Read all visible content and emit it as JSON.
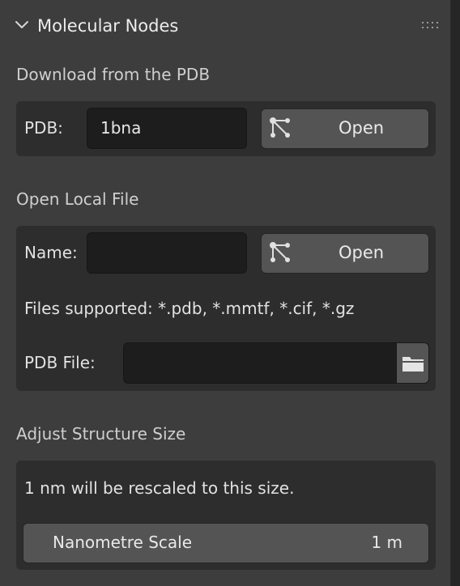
{
  "panel": {
    "title": "Molecular Nodes"
  },
  "download_section": {
    "title": "Download from the PDB",
    "pdb_label": "PDB:",
    "pdb_value": "1bna",
    "open_label": "Open"
  },
  "local_section": {
    "title": "Open Local File",
    "name_label": "Name:",
    "name_value": "",
    "open_label": "Open",
    "supported_text": "Files supported: *.pdb, *.mmtf, *.cif, *.gz",
    "file_label": "PDB File:",
    "file_value": ""
  },
  "scale_section": {
    "title": "Adjust Structure Size",
    "info_text": "1 nm will be rescaled to this size.",
    "slider_label": "Nanometre Scale",
    "slider_value": "1 m"
  },
  "icons": {
    "collapse": "chevron-down-icon",
    "drag": "drag-handle-icon",
    "node": "node-tree-icon",
    "folder": "folder-icon"
  }
}
